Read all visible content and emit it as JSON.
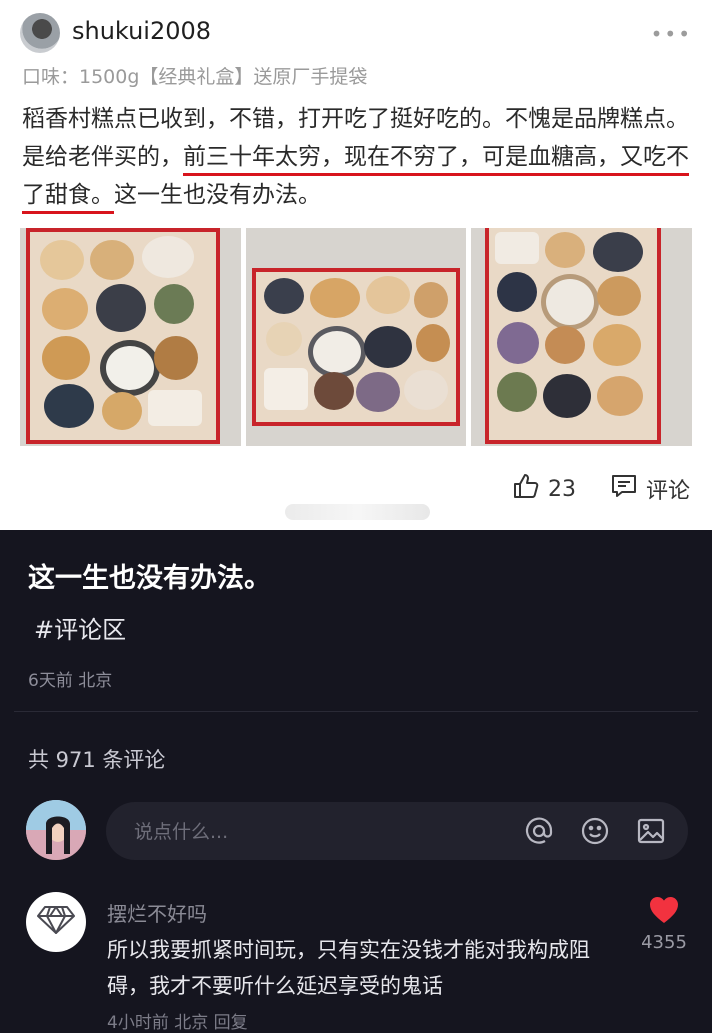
{
  "review": {
    "username": "shukui2008",
    "flavor": "口味：1500g【经典礼盒】送原厂手提袋",
    "text_part1": "稻香村糕点已收到，不错，打开吃了挺好吃的。不愧是品牌糕点。是给老伴买的，",
    "text_highlight": "前三十年太穷，现在不穷了，可是血糖高，又吃不了甜食。",
    "text_part2": "这一生也没有办法。",
    "photos": [
      "cake-gift-box-photo-1",
      "cake-gift-box-photo-2",
      "cake-gift-box-photo-3"
    ],
    "likes": "23",
    "comment_label": "评论",
    "icons": {
      "more": "more-dots-icon",
      "like": "thumbs-up-icon",
      "comment": "comment-icon"
    }
  },
  "post": {
    "title": "这一生也没有办法。",
    "hashtag": "#评论区",
    "meta": "6天前 北京"
  },
  "comments": {
    "count_text": "共 971 条评论",
    "input_placeholder": "说点什么...",
    "input_icons": [
      "at-icon",
      "emoji-icon",
      "image-icon"
    ],
    "items": [
      {
        "user": "摆烂不好吗",
        "text": "所以我要抓紧时间玩，只有实在没钱才能对我构成阻碍，我才不要听什么延迟享受的鬼话",
        "meta": "4小时前 北京 回复",
        "likes": "4355",
        "avatar_icon": "diamond-icon",
        "like_icon": "heart-icon"
      }
    ]
  },
  "colors": {
    "highlight_underline": "#d8141c",
    "dark_bg": "#15151f",
    "heart": "#f2323f"
  }
}
